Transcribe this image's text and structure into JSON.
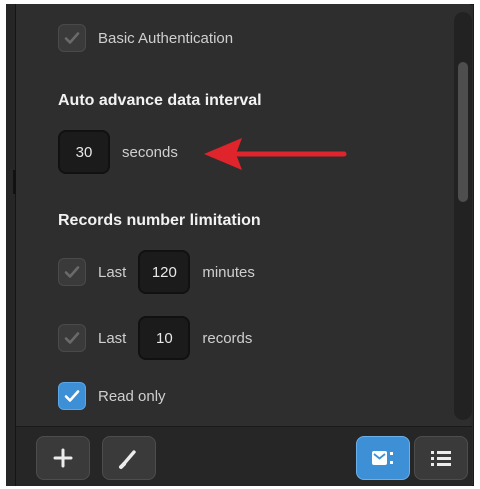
{
  "basic_auth": {
    "label": "Basic Authentication",
    "checked": true,
    "disabled": true
  },
  "auto_advance": {
    "heading": "Auto advance data interval",
    "value": "30",
    "unit": "seconds"
  },
  "records": {
    "heading": "Records number limitation",
    "last_minutes": {
      "prefix": "Last",
      "value": "120",
      "unit": "minutes",
      "checked": true,
      "disabled": true
    },
    "last_records": {
      "prefix": "Last",
      "value": "10",
      "unit": "records",
      "checked": true,
      "disabled": true
    }
  },
  "read_only": {
    "label": "Read only",
    "checked": true
  },
  "toolbar": {
    "add_icon": "plus-icon",
    "edit_icon": "brush-icon",
    "view_grid_icon": "card-view-icon",
    "view_list_icon": "list-view-icon"
  },
  "colors": {
    "accent": "#3d8fd6",
    "arrow": "#e0242b",
    "panel": "#2e2e2e"
  }
}
